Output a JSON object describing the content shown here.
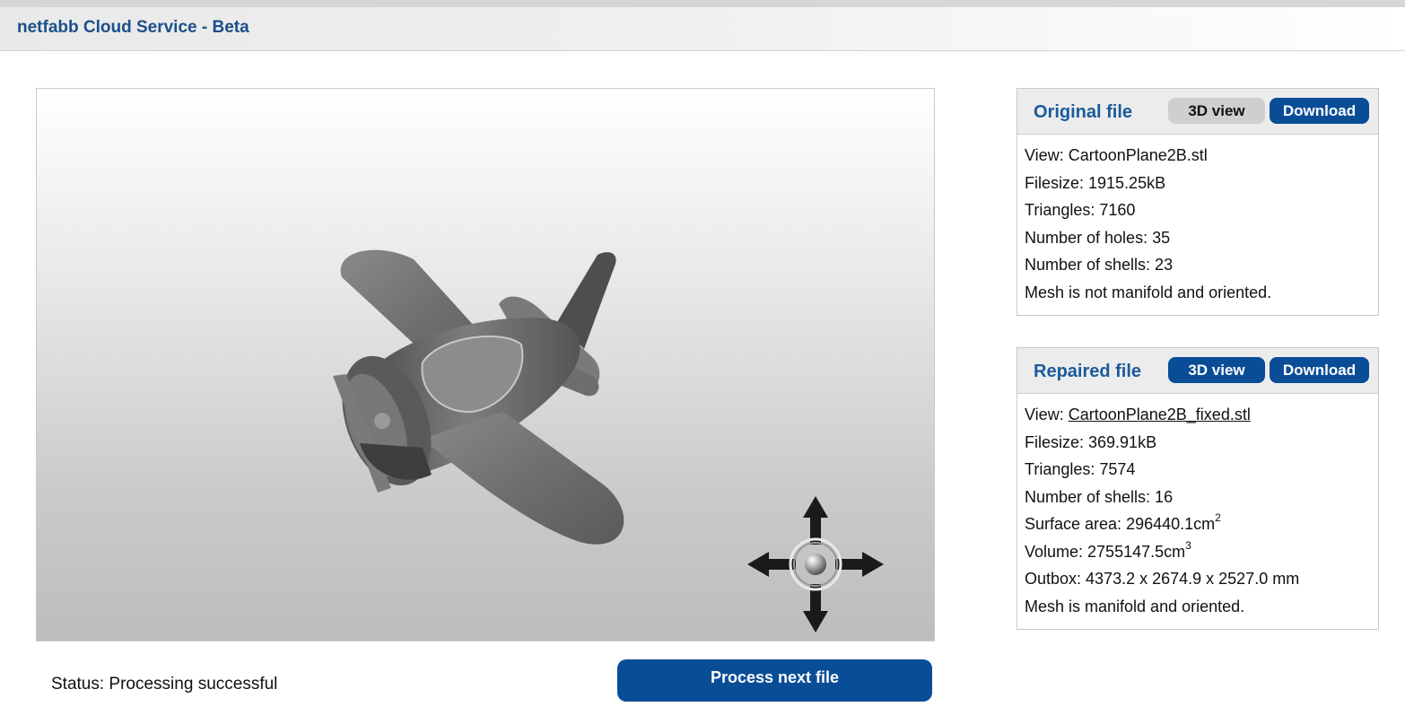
{
  "header": {
    "title": "netfabb Cloud Service - Beta"
  },
  "viewer": {
    "pan_control_icon": "four-way-arrows-icon"
  },
  "status": {
    "text": "Status: Processing successful"
  },
  "process_button": {
    "label": "Process next file"
  },
  "original": {
    "title": "Original file",
    "view3d_label": "3D view",
    "download_label": "Download",
    "view_label": "View: ",
    "view_file": "CartoonPlane2B.stl",
    "filesize": "Filesize: 1915.25kB",
    "triangles": "Triangles: 7160",
    "holes": "Number of holes: 35",
    "shells": "Number of shells: 23",
    "mesh": "Mesh is not manifold and oriented."
  },
  "repaired": {
    "title": "Repaired file",
    "view3d_label": "3D view",
    "download_label": "Download",
    "view_label": "View: ",
    "view_file": "CartoonPlane2B_fixed.stl",
    "filesize": "Filesize: 369.91kB",
    "triangles": "Triangles: 7574",
    "shells": "Number of shells: 16",
    "surface_label": "Surface area: 296440.1cm",
    "surface_exp": "2",
    "volume_label": "Volume: 2755147.5cm",
    "volume_exp": "3",
    "outbox": "Outbox: 4373.2 x 2674.9 x 2527.0 mm",
    "mesh": "Mesh is manifold and oriented."
  },
  "colors": {
    "brand_blue": "#0a4d97",
    "title_blue": "#1b4f8a"
  }
}
